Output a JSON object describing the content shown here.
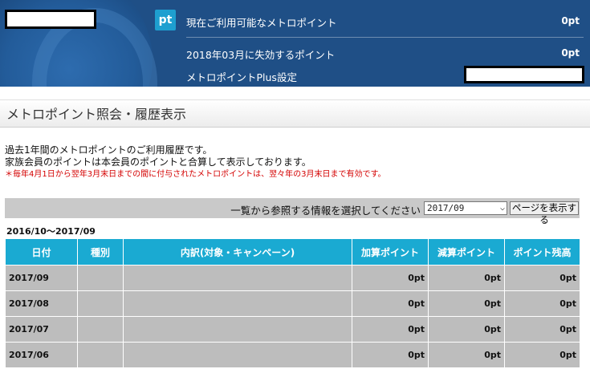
{
  "header": {
    "badge": "pt",
    "rows": [
      {
        "label": "現在ご利用可能なメトロポイント",
        "value": "0pt"
      },
      {
        "label": "2018年03月に失効するポイント",
        "value": "0pt"
      },
      {
        "label": "メトロポイントPlus設定",
        "value": ""
      }
    ]
  },
  "section": {
    "title": "メトロポイント照会・履歴表示"
  },
  "description": {
    "line1": "過去1年間のメトロポイントのご利用履歴です。",
    "line2": "家族会員のポイントは本会員のポイントと合算して表示しております。",
    "note": "＊毎年4月1日から翌年3月末日までの間に付与されたメトロポイントは、翌々年の3月末日まで有効です。"
  },
  "selector": {
    "label": "一覧から参照する情報を選択してください",
    "selected": "2017/09",
    "button": "ページを表示する"
  },
  "date_range": "2016/10～2017/09",
  "table": {
    "headers": [
      "日付",
      "種別",
      "内訳(対象・キャンペーン)",
      "加算ポイント",
      "減算ポイント",
      "ポイント残高"
    ],
    "rows": [
      {
        "date": "2017/09",
        "type": "",
        "detail": "",
        "add": "0pt",
        "sub": "0pt",
        "balance": "0pt"
      },
      {
        "date": "2017/08",
        "type": "",
        "detail": "",
        "add": "0pt",
        "sub": "0pt",
        "balance": "0pt"
      },
      {
        "date": "2017/07",
        "type": "",
        "detail": "",
        "add": "0pt",
        "sub": "0pt",
        "balance": "0pt"
      },
      {
        "date": "2017/06",
        "type": "",
        "detail": "",
        "add": "0pt",
        "sub": "0pt",
        "balance": "0pt"
      }
    ]
  }
}
